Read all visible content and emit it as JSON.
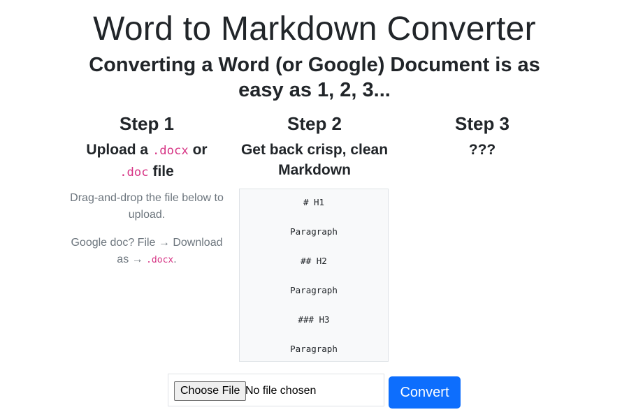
{
  "header": {
    "title": "Word to Markdown Converter",
    "subtitle": "Converting a Word (or Google) Document is as easy as 1, 2, 3..."
  },
  "steps": [
    {
      "heading": "Step 1",
      "desc_prefix": "Upload a ",
      "desc_code1": ".docx",
      "desc_mid": " or",
      "desc_code2": ".doc",
      "desc_suffix": " file",
      "help1": "Drag-and-drop the file below to upload.",
      "help2_prefix": "Google doc? File → Download as → ",
      "help2_code": ".docx",
      "help2_suffix": "."
    },
    {
      "heading": "Step 2",
      "desc": "Get back crisp, clean Markdown"
    },
    {
      "heading": "Step 3",
      "desc": "???"
    }
  ],
  "markdown_sample": [
    "# H1",
    "Paragraph",
    "## H2",
    "Paragraph",
    "### H3",
    "Paragraph"
  ],
  "upload": {
    "choose_label": "Choose File",
    "status": "No file chosen",
    "convert_label": "Convert"
  },
  "colors": {
    "primary": "#0d6efd",
    "code": "#d63384",
    "muted": "#6c757d"
  }
}
